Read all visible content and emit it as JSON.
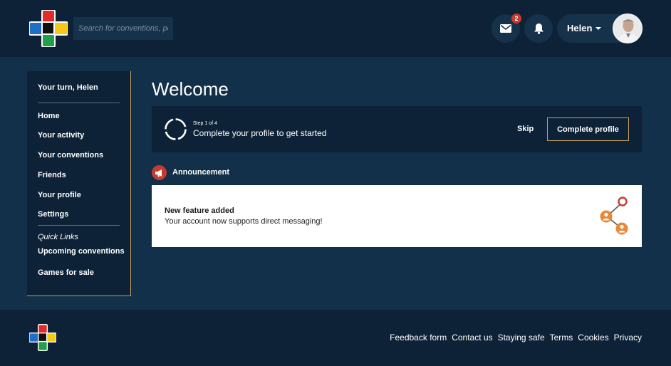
{
  "header": {
    "search_placeholder": "Search for conventions, people",
    "mail_badge": "2",
    "user_name": "Helen"
  },
  "sidebar": {
    "title": "Your turn, Helen",
    "items": [
      {
        "label": "Home"
      },
      {
        "label": "Your activity"
      },
      {
        "label": "Your conventions"
      },
      {
        "label": "Friends"
      },
      {
        "label": "Your profile"
      },
      {
        "label": "Settings"
      }
    ],
    "quick_links_label": "Quick Links",
    "quick_links": [
      {
        "label": "Upcoming conventions"
      },
      {
        "label": "Games for sale"
      }
    ]
  },
  "main": {
    "title": "Welcome",
    "progress": {
      "step_text": "Step 1 of 4",
      "message": "Complete your profile to get started",
      "skip_label": "Skip",
      "complete_label": "Complete profile",
      "current_step": 1,
      "total_steps": 4
    },
    "announcement": {
      "label": "Announcement",
      "title": "New feature added",
      "body": "Your account now supports direct messaging!"
    }
  },
  "footer": {
    "links": [
      "Feedback form",
      "Contact us",
      "Staying safe",
      "Terms",
      "Cookies",
      "Privacy"
    ]
  },
  "colors": {
    "page_bg": "#123049",
    "panel_bg": "#0d2237",
    "accent_gold": "#c8a062",
    "alert_red": "#c83a2e",
    "illustration_orange": "#e8893a",
    "logo_red": "#e32b2b",
    "logo_blue": "#1f6fc8",
    "logo_yellow": "#f6c918",
    "logo_green": "#20a048"
  },
  "icons": {
    "mail": "envelope-icon",
    "bell": "bell-icon",
    "announcement": "megaphone-icon",
    "progress": "progress-ring-icon",
    "illustration": "people-connection-icon"
  }
}
